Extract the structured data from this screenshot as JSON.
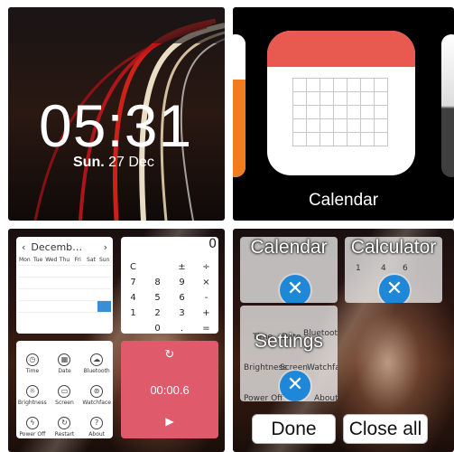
{
  "lockscreen": {
    "time": "05:31",
    "day": "Sun.",
    "date": "27 Dec"
  },
  "carousel": {
    "app_label": "Calendar",
    "left_app_color": "#f07d1f",
    "right_app_color": "#3f3f3f",
    "calendar_accent": "#e85a4f"
  },
  "home": {
    "calendar_widget": {
      "month": "Decemb…",
      "prev_icon": "chevron-left-icon",
      "next_icon": "chevron-right-icon",
      "weekdays": [
        "Mon",
        "Tue",
        "Wed",
        "Thu",
        "Fri",
        "Sat",
        "Sun"
      ]
    },
    "calculator_widget": {
      "display": "0",
      "keys": [
        "C",
        "",
        "±",
        "÷",
        "7",
        "8",
        "9",
        "×",
        "4",
        "5",
        "6",
        "-",
        "1",
        "2",
        "3",
        "+",
        "",
        "0",
        ".",
        "="
      ]
    },
    "settings_widget": {
      "items": [
        {
          "label": "Time",
          "icon": "clock-icon",
          "glyph": "◷"
        },
        {
          "label": "Date",
          "icon": "calendar-icon",
          "glyph": "▦"
        },
        {
          "label": "Bluetooth",
          "icon": "cloud-icon",
          "glyph": "☁"
        },
        {
          "label": "Brightness",
          "icon": "sun-icon",
          "glyph": "☼"
        },
        {
          "label": "Screen",
          "icon": "screen-icon",
          "glyph": "▭"
        },
        {
          "label": "Watchface",
          "icon": "watchface-icon",
          "glyph": "⊚"
        },
        {
          "label": "Power Off",
          "icon": "power-icon",
          "glyph": "ϟ"
        },
        {
          "label": "Restart",
          "icon": "restart-icon",
          "glyph": "↻"
        },
        {
          "label": "About",
          "icon": "help-icon",
          "glyph": "?"
        }
      ]
    },
    "stopwatch_widget": {
      "reset_glyph": "↻",
      "time": "00:00.6",
      "play_glyph": "▶",
      "color": "#df5b6b"
    }
  },
  "recents": {
    "cards": [
      {
        "title": "Calendar"
      },
      {
        "title": "Calculator"
      },
      {
        "title": "Settings"
      }
    ],
    "close_glyph": "✕",
    "done_label": "Done",
    "close_all_label": "Close all",
    "accent": "#1e87d8"
  }
}
